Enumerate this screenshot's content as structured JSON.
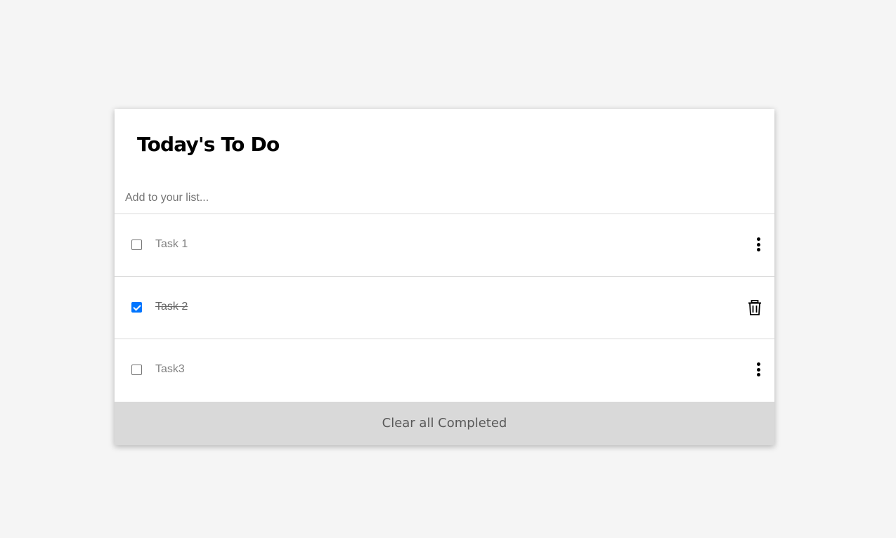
{
  "header": {
    "title": "Today's To Do"
  },
  "add_input": {
    "placeholder": "Add to your list...",
    "value": ""
  },
  "tasks": [
    {
      "label": "Task 1",
      "completed": false,
      "action_icon": "more-vertical-icon"
    },
    {
      "label": "Task 2",
      "completed": true,
      "action_icon": "trash-icon"
    },
    {
      "label": "Task3",
      "completed": false,
      "action_icon": "more-vertical-icon"
    }
  ],
  "footer": {
    "clear_label": "Clear all Completed"
  },
  "colors": {
    "background": "#f5f5f5",
    "card": "#ffffff",
    "checkbox_checked": "#0075ff",
    "footer_bg": "#d9d9d9"
  }
}
